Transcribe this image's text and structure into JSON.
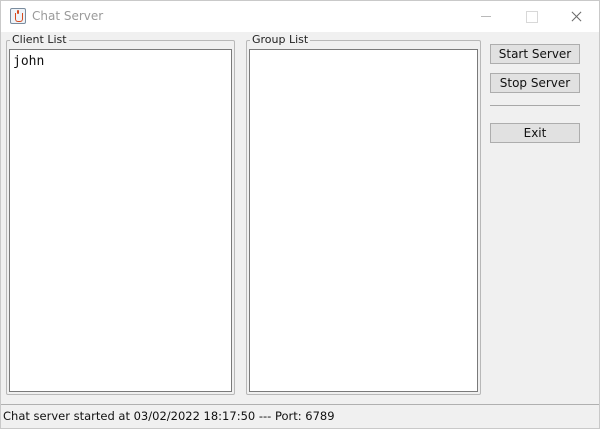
{
  "window": {
    "title": "Chat Server",
    "icon": "java-cup-icon",
    "controls": [
      "minimize-icon",
      "maximize-icon",
      "close-icon"
    ]
  },
  "client_list": {
    "label": "Client List",
    "items": [
      "john"
    ]
  },
  "group_list": {
    "label": "Group List",
    "items": []
  },
  "buttons": {
    "start": "Start Server",
    "stop": "Stop Server",
    "exit": "Exit"
  },
  "status": {
    "text": "Chat server started at 03/02/2022 18:17:50 --- Port: 6789"
  }
}
